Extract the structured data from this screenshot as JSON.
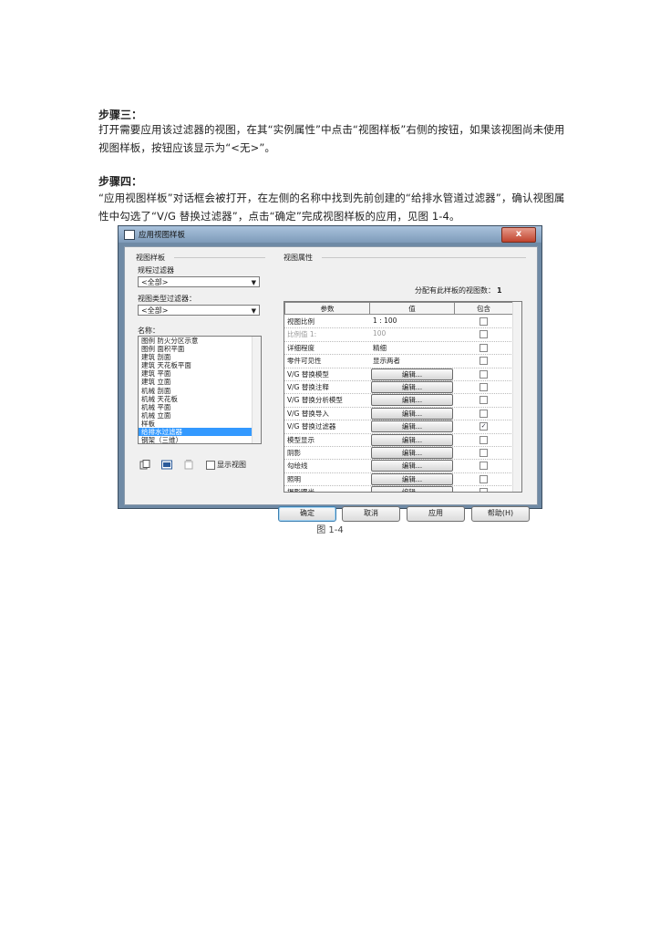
{
  "doc": {
    "step3_heading": "步骤三：",
    "step3_text": "打开需要应用该过滤器的视图，在其“实例属性”中点击“视图样板”右侧的按钮，如果该视图尚未使用视图样板，按钮应该显示为“<无>”。",
    "step4_heading": "步骤四：",
    "step4_text": "“应用视图样板”对话框会被打开，在左侧的名称中找到先前创建的“给排水管道过滤器”，确认视图属性中勾选了“V/G 替换过滤器”，点击“确定”完成视图样板的应用，见图 1-4。",
    "caption": "图 1-4"
  },
  "dialog": {
    "title": "应用视图样板",
    "close_label": "x",
    "left": {
      "group_label": "视图样板",
      "discipline_label": "规程过滤器",
      "discipline_value": "<全部>",
      "viewtype_label": "视图类型过滤器：",
      "viewtype_value": "<全部>",
      "names_label": "名称：",
      "names": [
        "图例 防火分区示意",
        "图例 面积平面",
        "建筑 剖面",
        "建筑 天花板平面",
        "建筑 平面",
        "建筑 立面",
        "机械 剖面",
        "机械 天花板",
        "机械 平面",
        "机械 立面",
        "样板",
        "给排水过滤器",
        "钢架（三维）_"
      ],
      "selected_index": 11,
      "show_views_label": "显示视图"
    },
    "right": {
      "group_label": "视图属性",
      "count_label": "分配有此样板的视图数：",
      "count_value": "1",
      "headers": [
        "参数",
        "值",
        "包含"
      ],
      "rows": [
        {
          "param": "视图比例",
          "value": "1 : 100",
          "button": false,
          "checked": false,
          "gray": false
        },
        {
          "param": "比例值 1:",
          "value": "100",
          "button": false,
          "checked": false,
          "gray": true
        },
        {
          "param": "详细程度",
          "value": "精细",
          "button": false,
          "checked": false,
          "gray": false
        },
        {
          "param": "零件可见性",
          "value": "显示两者",
          "button": false,
          "checked": false,
          "gray": false
        },
        {
          "param": "V/G 替换模型",
          "value": "编辑...",
          "button": true,
          "checked": false,
          "gray": false
        },
        {
          "param": "V/G 替换注释",
          "value": "编辑...",
          "button": true,
          "checked": false,
          "gray": false
        },
        {
          "param": "V/G 替换分析模型",
          "value": "编辑...",
          "button": true,
          "checked": false,
          "gray": false
        },
        {
          "param": "V/G 替换导入",
          "value": "编辑...",
          "button": true,
          "checked": false,
          "gray": false
        },
        {
          "param": "V/G 替换过滤器",
          "value": "编辑...",
          "button": true,
          "checked": true,
          "gray": false
        },
        {
          "param": "模型显示",
          "value": "编辑...",
          "button": true,
          "checked": false,
          "gray": false
        },
        {
          "param": "阴影",
          "value": "编辑...",
          "button": true,
          "checked": false,
          "gray": false
        },
        {
          "param": "勾绘线",
          "value": "编辑...",
          "button": true,
          "checked": false,
          "gray": false
        },
        {
          "param": "照明",
          "value": "编辑...",
          "button": true,
          "checked": false,
          "gray": false
        },
        {
          "param": "摄影曝光",
          "value": "编辑...",
          "button": true,
          "checked": false,
          "gray": false
        }
      ]
    },
    "buttons": {
      "ok": "确定",
      "cancel": "取消",
      "apply": "应用",
      "help": "帮助(H)"
    }
  }
}
